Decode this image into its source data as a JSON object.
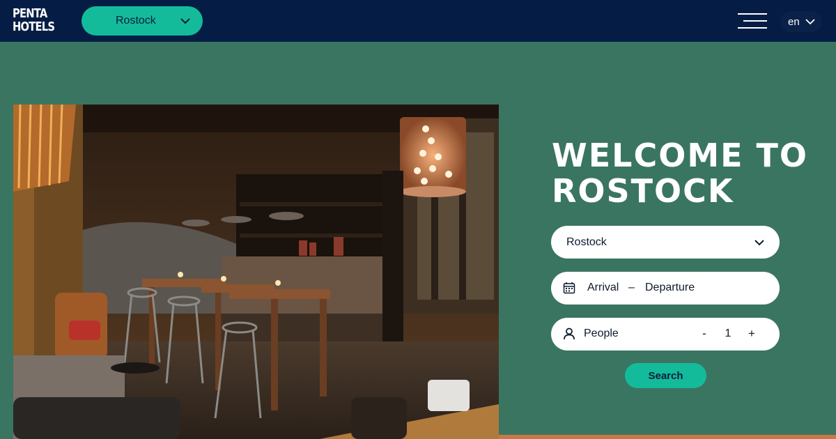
{
  "header": {
    "logo_line1": "PENTA",
    "logo_line2": "HOTELS",
    "city_selector": "Rostock",
    "language": "en",
    "menu_icon": "hamburger-menu-icon"
  },
  "hero": {
    "image": "hotel-lounge-photo"
  },
  "booking": {
    "title_line1": "WELCOME TO",
    "title_line2": "ROSTOCK",
    "city_value": "Rostock",
    "arrival_label": "Arrival",
    "date_separator": "–",
    "departure_label": "Departure",
    "people_label": "People",
    "decrement_label": "-",
    "people_count": "1",
    "increment_label": "+",
    "search_label": "Search"
  },
  "colors": {
    "header_bg": "#051d44",
    "page_bg": "#3a7561",
    "accent": "#14bb9b",
    "strip": "#c77a45"
  }
}
